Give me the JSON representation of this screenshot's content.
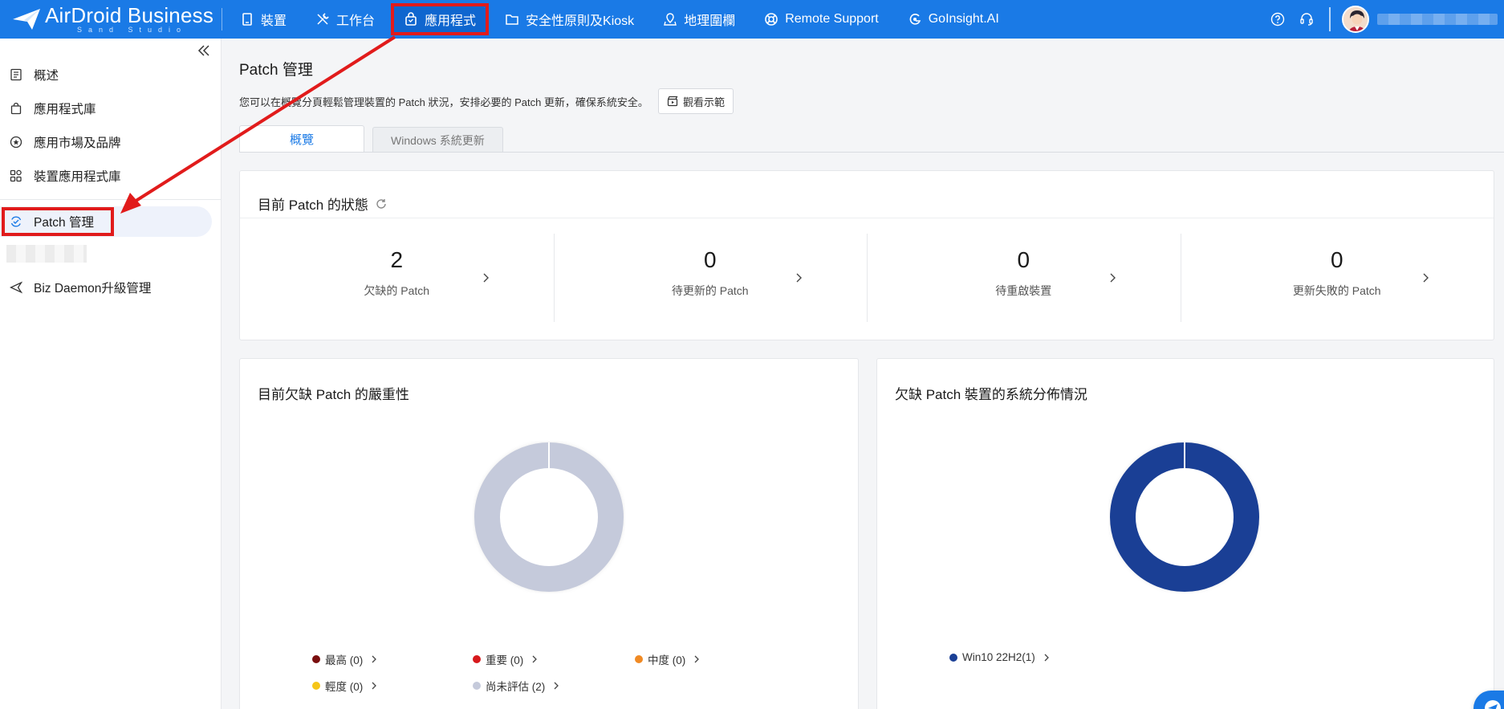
{
  "brand": {
    "name": "AirDroid Business",
    "sub": "Sand Studio"
  },
  "nav": {
    "items": [
      {
        "label": "裝置",
        "icon": "device-icon"
      },
      {
        "label": "工作台",
        "icon": "tools-icon"
      },
      {
        "label": "應用程式",
        "icon": "app-bag-icon"
      },
      {
        "label": "安全性原則及Kiosk",
        "icon": "folder-icon"
      },
      {
        "label": "地理圍欄",
        "icon": "geofence-icon"
      },
      {
        "label": "Remote Support",
        "icon": "lifebuoy-icon"
      },
      {
        "label": "GoInsight.AI",
        "icon": "goinsight-icon"
      }
    ],
    "active": "應用程式"
  },
  "sidebar": {
    "items": [
      {
        "label": "概述"
      },
      {
        "label": "應用程式庫"
      },
      {
        "label": "應用市場及品牌"
      },
      {
        "label": "裝置應用程式庫"
      },
      {
        "label": "Patch 管理"
      },
      {
        "label": "Biz Daemon升級管理"
      }
    ]
  },
  "page": {
    "title": "Patch 管理",
    "description": "您可以在概覽分頁輕鬆管理裝置的 Patch 狀況，安排必要的 Patch 更新，確保系統安全。",
    "demo_button": "觀看示範",
    "tabs": [
      "概覽",
      "Windows 系統更新"
    ]
  },
  "status": {
    "title": "目前 Patch 的狀態",
    "stats": [
      {
        "value": "2",
        "label": "欠缺的 Patch"
      },
      {
        "value": "0",
        "label": "待更新的 Patch"
      },
      {
        "value": "0",
        "label": "待重啟裝置"
      },
      {
        "value": "0",
        "label": "更新失敗的 Patch"
      }
    ]
  },
  "severity": {
    "title": "目前欠缺 Patch 的嚴重性",
    "legend": [
      {
        "label": "最高 (0)",
        "color": "#7a0e0e"
      },
      {
        "label": "重要 (0)",
        "color": "#d7191c"
      },
      {
        "label": "中度 (0)",
        "color": "#f08a24"
      },
      {
        "label": "輕度 (0)",
        "color": "#f5c518"
      },
      {
        "label": "尚未評估 (2)",
        "color": "#c5cadb"
      }
    ]
  },
  "distribution": {
    "title": "欠缺 Patch 裝置的系統分佈情況",
    "legend": [
      {
        "label": "Win10 22H2(1)",
        "color": "#1a3f95"
      }
    ]
  },
  "chart_data": [
    {
      "type": "pie",
      "title": "目前欠缺 Patch 的嚴重性",
      "categories": [
        "最高",
        "重要",
        "中度",
        "輕度",
        "尚未評估"
      ],
      "values": [
        0,
        0,
        0,
        0,
        2
      ]
    },
    {
      "type": "pie",
      "title": "欠缺 Patch 裝置的系統分佈情況",
      "categories": [
        "Win10 22H2"
      ],
      "values": [
        1
      ]
    }
  ]
}
